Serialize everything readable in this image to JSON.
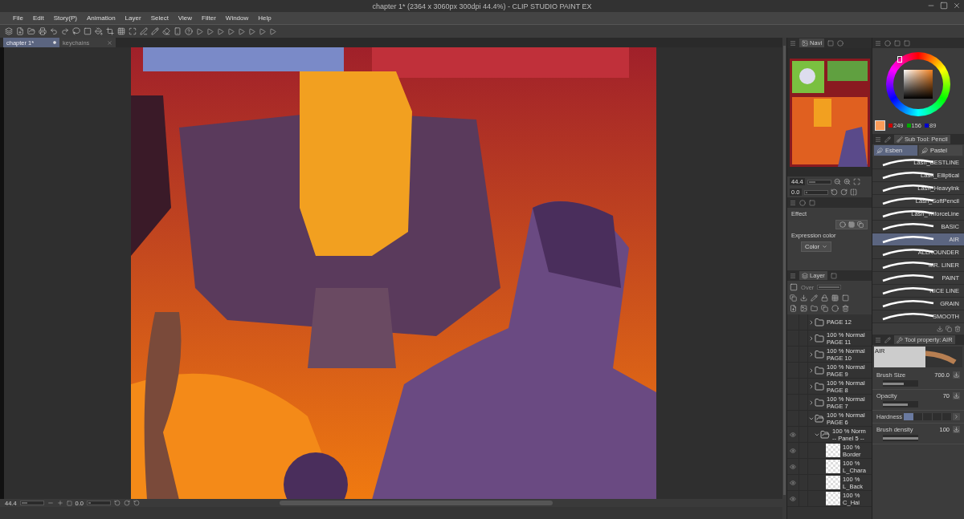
{
  "window": {
    "title": "chapter 1* (2364 x 3060px 300dpi 44.4%) - CLIP STUDIO PAINT EX"
  },
  "menu": [
    "File",
    "Edit",
    "Story(P)",
    "Animation",
    "Layer",
    "Select",
    "View",
    "Filter",
    "Window",
    "Help"
  ],
  "document_tabs": [
    {
      "label": "chapter 1*",
      "selected": true
    },
    {
      "label": "keychains",
      "selected": false
    }
  ],
  "canvas_status": {
    "zoom": {
      "value": "44.4",
      "level": 0.3
    },
    "rotation": {
      "value": "0.0",
      "level": 0.1
    }
  },
  "navigator": {
    "tab": "Navi",
    "zoom": {
      "value": "44.4",
      "level": 0.3
    },
    "rotation": {
      "value": "0.0",
      "level": 0.1
    }
  },
  "effect": {
    "label": "Effect",
    "expression_color_label": "Expression color",
    "expression_color": "Color"
  },
  "layer_panel": {
    "tab": "Layer",
    "blend_mode": "Over",
    "opacity": {
      "level": 1
    }
  },
  "layers": [
    {
      "kind": "folder",
      "name": "PAGE 12",
      "expanded": false,
      "visible": false
    },
    {
      "kind": "folder",
      "mode": "100 % Normal",
      "name": "PAGE 11",
      "expanded": false,
      "visible": false
    },
    {
      "kind": "folder",
      "mode": "100 % Normal",
      "name": "PAGE 10",
      "expanded": false,
      "visible": false
    },
    {
      "kind": "folder",
      "mode": "100 % Normal",
      "name": "PAGE 9",
      "expanded": false,
      "visible": false
    },
    {
      "kind": "folder",
      "mode": "100 % Normal",
      "name": "PAGE 8",
      "expanded": false,
      "visible": false
    },
    {
      "kind": "folder",
      "mode": "100 % Normal",
      "name": "PAGE 7",
      "expanded": false,
      "visible": false
    },
    {
      "kind": "folder",
      "mode": "100 % Normal",
      "name": "PAGE 6",
      "expanded": true,
      "visible": false,
      "children": [
        {
          "kind": "folder",
          "mode": "100 % Norm",
          "name": "-- Panel 5 --",
          "expanded": true,
          "visible": true,
          "children": [
            {
              "kind": "layer",
              "mode": "100 %",
              "name": "Border",
              "visible": true
            },
            {
              "kind": "layer",
              "mode": "100 %",
              "name": "L_Chara",
              "visible": true
            },
            {
              "kind": "layer",
              "mode": "100 %",
              "name": "L_Back",
              "visible": true
            },
            {
              "kind": "layer",
              "mode": "100 %",
              "name": "C_Hai",
              "visible": true
            }
          ]
        }
      ]
    }
  ],
  "color_panel": {
    "color": "#f99c59",
    "r": "249",
    "g": "156",
    "b": "89"
  },
  "sub_tool": {
    "title": "Sub Tool: Pencil",
    "groups": [
      {
        "label": "Esben",
        "selected": true
      },
      {
        "label": "Pastel",
        "selected": false
      }
    ],
    "brushes": [
      {
        "name": "Lash_BESTLINE",
        "selected": false
      },
      {
        "name": "Lash_Elliptical",
        "selected": false
      },
      {
        "name": "Lash_HeavyInk",
        "selected": false
      },
      {
        "name": "Lash_SoftPencil",
        "selected": false
      },
      {
        "name": "Lash_TriforceLine",
        "selected": false
      },
      {
        "name": "BASIC",
        "selected": false
      },
      {
        "name": "AIR",
        "selected": true
      },
      {
        "name": "ALLROUNDER",
        "selected": false
      },
      {
        "name": "MR. LINER",
        "selected": false
      },
      {
        "name": "PAINT",
        "selected": false
      },
      {
        "name": "NICE LINE",
        "selected": false
      },
      {
        "name": "GRAIN",
        "selected": false
      },
      {
        "name": "SMOOTH",
        "selected": false
      }
    ]
  },
  "tool_property": {
    "title": "Tool property: AIR",
    "preview_label": "AIR",
    "properties": [
      {
        "kind": "slider",
        "label": "Brush Size",
        "value": "700.0",
        "level": 0.6
      },
      {
        "kind": "slider",
        "label": "Opacity",
        "value": "70",
        "level": 0.7
      },
      {
        "kind": "steps",
        "label": "Hardness",
        "level": 0.2
      },
      {
        "kind": "slider",
        "label": "Brush density",
        "value": "100",
        "level": 1
      }
    ]
  }
}
